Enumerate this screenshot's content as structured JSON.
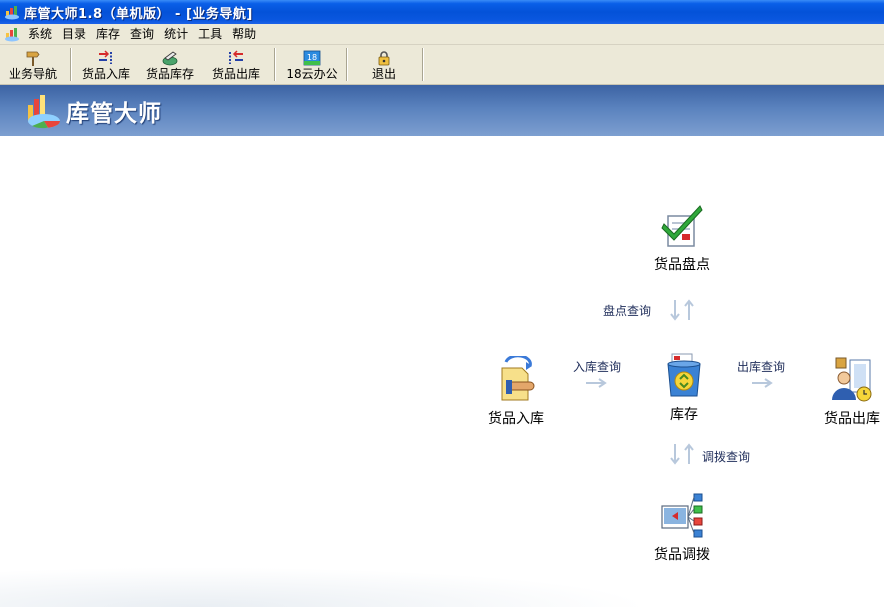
{
  "window": {
    "title": "库管大师1.8（单机版） - [业务导航]"
  },
  "menu": {
    "items": [
      "系统",
      "目录",
      "库存",
      "查询",
      "统计",
      "工具",
      "帮助"
    ]
  },
  "toolbar": {
    "nav": "业务导航",
    "stock_in": "货品入库",
    "inventory": "货品库存",
    "stock_out": "货品出库",
    "cloud_office": "18云办公",
    "exit": "退出",
    "calendar_day": "18"
  },
  "banner": {
    "title": "库管大师"
  },
  "flow": {
    "stocktake": "货品盘点",
    "stock_in": "货品入库",
    "storage": "库存",
    "stock_out": "货品出库",
    "transfer": "货品调拨",
    "stocktake_query": "盘点查询",
    "in_query": "入库查询",
    "out_query": "出库查询",
    "transfer_query": "调拨查询"
  },
  "colors": {
    "titlebar": "#0452d8",
    "banner": "#5a82be",
    "chrome": "#ece9d8"
  }
}
